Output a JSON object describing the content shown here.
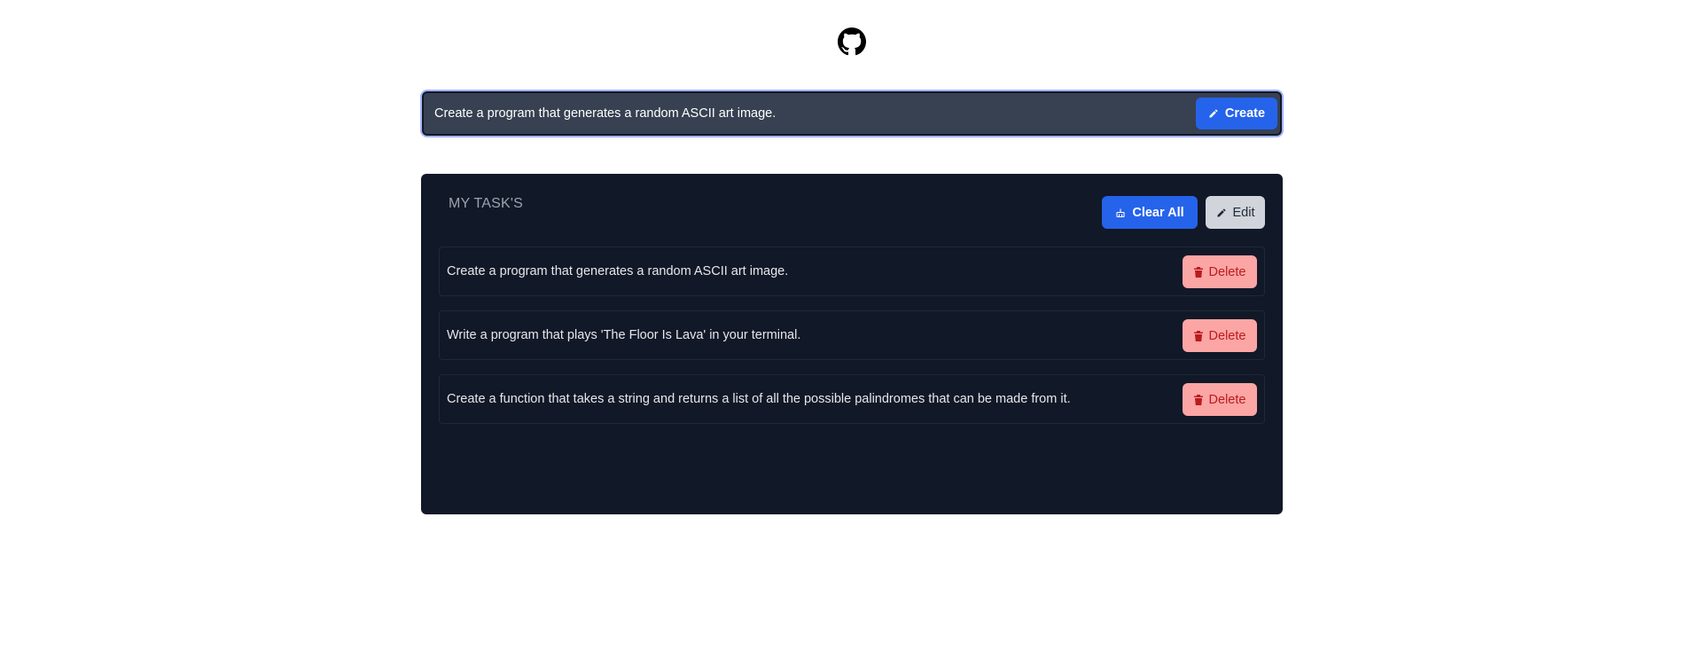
{
  "header": {
    "github_icon": "github-icon"
  },
  "composer": {
    "input_value": "Create a program that generates a random ASCII art image.",
    "create_label": "Create",
    "create_icon": "pencil-icon"
  },
  "tasks_panel": {
    "title": "MY TASK'S",
    "clear_all_label": "Clear All",
    "clear_all_icon": "broom-icon",
    "edit_label": "Edit",
    "edit_icon": "pencil-icon",
    "items": [
      {
        "text": "Create a program that generates a random ASCII art image.",
        "delete_label": "Delete"
      },
      {
        "text": "Write a program that plays 'The Floor Is Lava' in your terminal.",
        "delete_label": "Delete"
      },
      {
        "text": "Create a function that takes a string and returns a list of all the possible palindromes that can be made from it.",
        "delete_label": "Delete"
      }
    ]
  },
  "colors": {
    "accent": "#2563eb",
    "panel_bg": "#111827",
    "input_bg": "#374151",
    "delete_bg": "#fca5a5",
    "delete_text": "#b91c1c",
    "edit_bg": "#d1d5db"
  }
}
